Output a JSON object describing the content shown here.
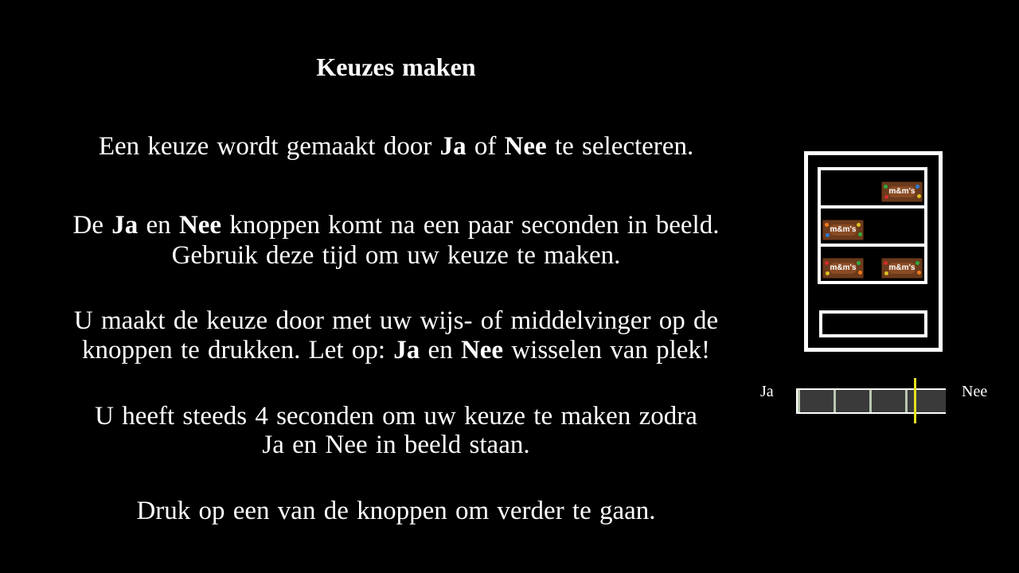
{
  "slide": {
    "title": "Keuzes maken",
    "paragraphs": [
      {
        "lines": [
          [
            "Een keuze wordt gemaakt door ",
            {
              "b": "Ja"
            },
            " of ",
            {
              "b": "Nee"
            },
            " te selecteren."
          ]
        ]
      },
      {
        "lines": [
          [
            "De ",
            {
              "b": "Ja"
            },
            " en ",
            {
              "b": "Nee"
            },
            " knoppen komt na een paar seconden in beeld."
          ],
          [
            "Gebruik deze tijd om uw keuze te maken."
          ]
        ]
      },
      {
        "lines": [
          [
            "U maakt de keuze door met uw wijs- of middelvinger op de"
          ],
          [
            "knoppen te drukken. Let op: ",
            {
              "b": "Ja"
            },
            " en ",
            {
              "b": "Nee"
            },
            " wisselen van plek!"
          ]
        ]
      },
      {
        "lines": [
          [
            "U heeft steeds 4 seconden om uw keuze te maken zodra"
          ],
          [
            "Ja en Nee in beeld staan."
          ]
        ]
      },
      {
        "lines": [
          [
            "Druk op een van de knoppen om verder te gaan."
          ]
        ]
      }
    ]
  },
  "machine": {
    "candy_label": "m&m's",
    "candy_color": "#6b3a1c",
    "shelves": [
      {
        "items": [
          "right"
        ]
      },
      {
        "items": [
          "left"
        ]
      },
      {
        "items": [
          "left",
          "right"
        ]
      }
    ]
  },
  "timer": {
    "left_label": "Ja",
    "right_label": "Nee",
    "segments": 4,
    "indicator_color": "#e6e020"
  }
}
